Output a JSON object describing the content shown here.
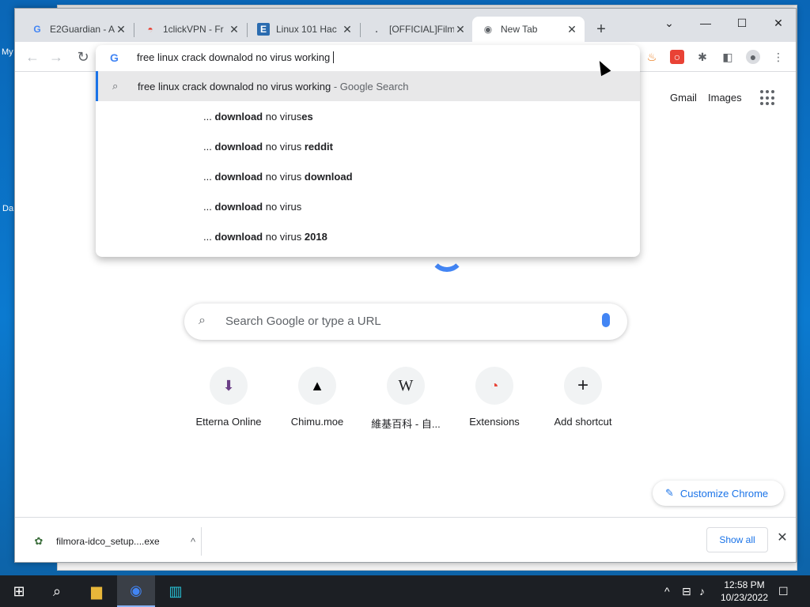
{
  "desktop": {
    "frag_top": "My",
    "frag_bottom": "Da"
  },
  "tabs": [
    {
      "label": "E2Guardian - A",
      "icon": "google-g-icon"
    },
    {
      "label": "1clickVPN - Fr",
      "icon": "vpn-icon"
    },
    {
      "label": "Linux 101 Hac",
      "icon": "linux-icon"
    },
    {
      "label": "[OFFICIAL]Film",
      "icon": "blank-icon"
    },
    {
      "label": "New Tab",
      "icon": "chrome-icon"
    }
  ],
  "omnibox": {
    "logo": "G",
    "query": "free linux crack downalod no virus working",
    "suggestions": [
      {
        "prefix": "free linux crack downalod no virus working",
        "bold": "",
        "suffix": "",
        "hint": " - Google Search"
      },
      {
        "prefix": "... ",
        "bold": "download",
        "suffix": " no virus",
        "tail_bold": "es"
      },
      {
        "prefix": "... ",
        "bold": "download",
        "suffix": " no virus ",
        "tail_bold": "reddit"
      },
      {
        "prefix": "... ",
        "bold": "download",
        "suffix": " no virus ",
        "tail_bold": "download"
      },
      {
        "prefix": "... ",
        "bold": "download",
        "suffix": " no virus",
        "tail_bold": ""
      },
      {
        "prefix": "... ",
        "bold": "download",
        "suffix": " no virus ",
        "tail_bold": "2018"
      }
    ]
  },
  "ntp": {
    "gmail": "Gmail",
    "images": "Images",
    "search_placeholder": "Search Google or type a URL",
    "shortcuts": [
      {
        "label": "Etterna Online",
        "glyph": "⬇"
      },
      {
        "label": "Chimu.moe",
        "glyph": "▲"
      },
      {
        "label": "維基百科 - 自...",
        "glyph": "W"
      },
      {
        "label": "Extensions",
        "glyph": "◔"
      },
      {
        "label": "Add shortcut",
        "glyph": "+"
      }
    ],
    "customize": "Customize Chrome"
  },
  "download": {
    "filename": "filmora-idco_setup....exe",
    "show_all": "Show all"
  },
  "taskbar": {
    "time": "12:58 PM",
    "date": "10/23/2022"
  },
  "colors": {
    "accent": "#1a73e8",
    "google_blue": "#4285f4"
  }
}
